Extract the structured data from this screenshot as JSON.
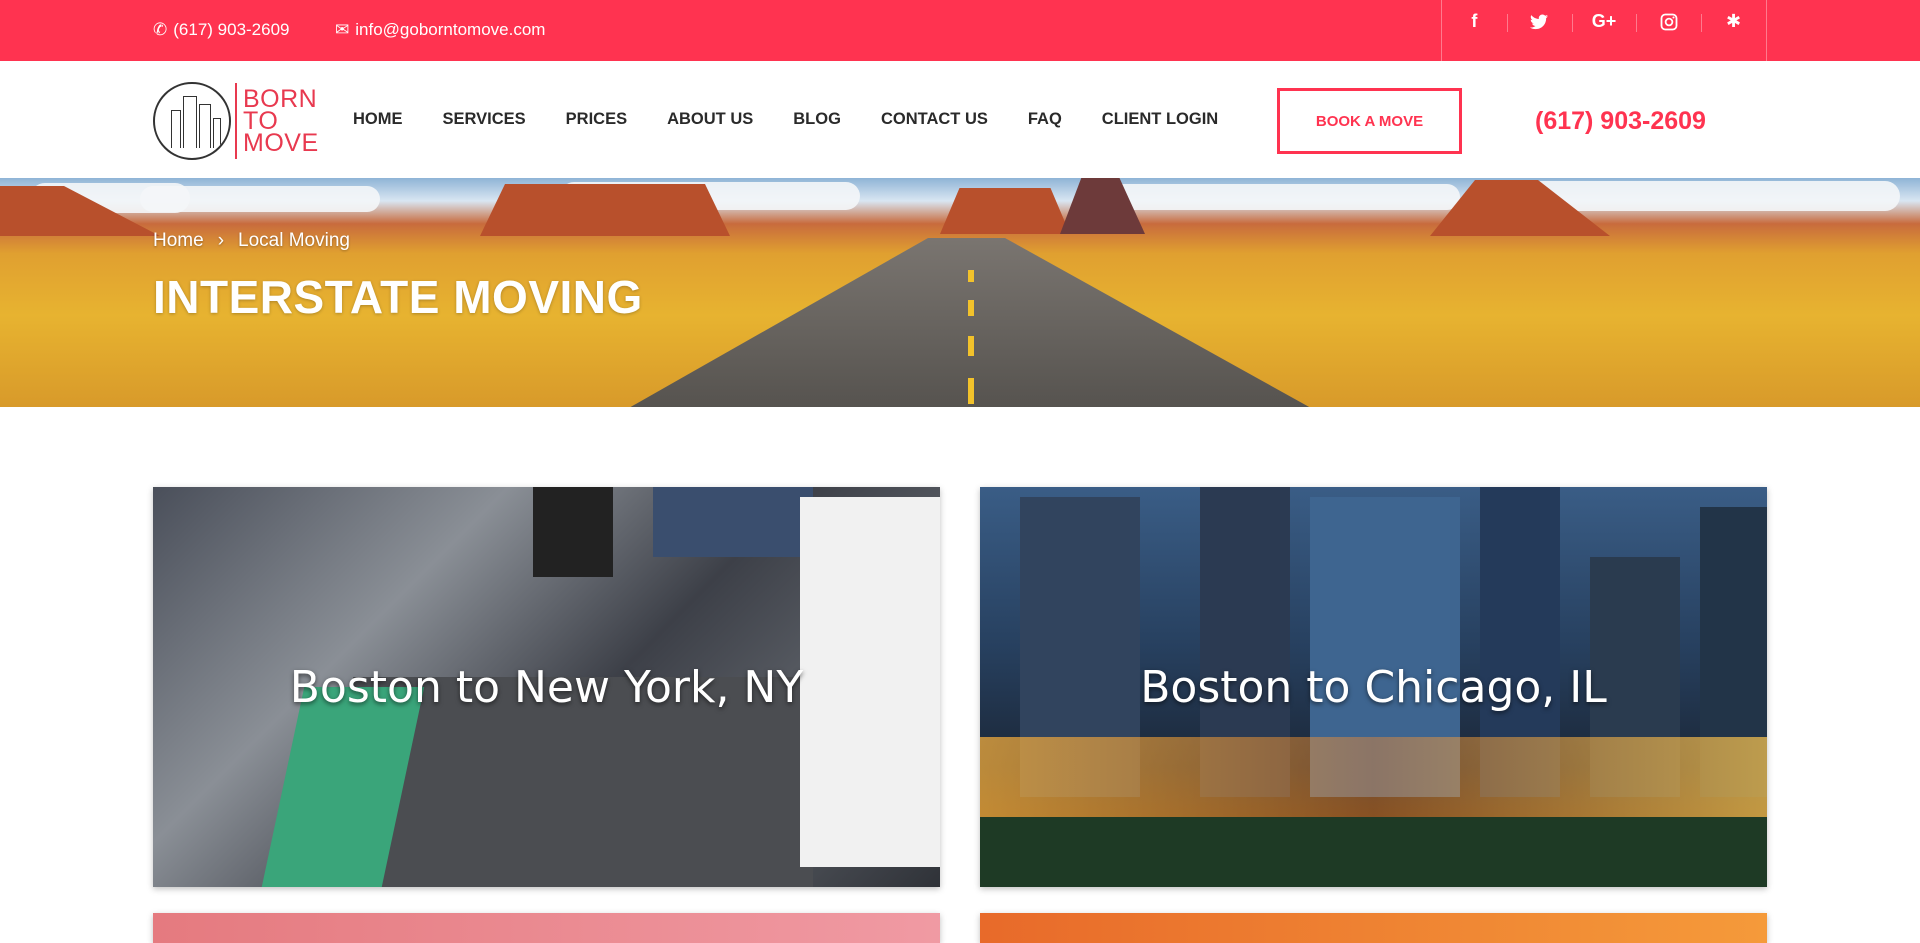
{
  "topbar": {
    "phone": "(617) 903-2609",
    "email": "info@goborntomove.com",
    "social": [
      {
        "icon": "facebook-icon",
        "glyph": "f"
      },
      {
        "icon": "twitter-icon",
        "glyph": "🐦"
      },
      {
        "icon": "google-plus-icon",
        "glyph": "G+"
      },
      {
        "icon": "instagram-icon",
        "glyph": "◎"
      },
      {
        "icon": "yelp-icon",
        "glyph": "✱"
      }
    ]
  },
  "header": {
    "logo": {
      "line1": "BORN",
      "line2": "TO",
      "line3": "MOVE"
    },
    "nav": [
      "HOME",
      "SERVICES",
      "PRICES",
      "ABOUT US",
      "BLOG",
      "CONTACT US",
      "FAQ",
      "CLIENT LOGIN"
    ],
    "book_label": "BOOK A MOVE",
    "phone": "(617) 903-2609"
  },
  "hero": {
    "breadcrumb": [
      "Home",
      "Local Moving"
    ],
    "separator": "›",
    "title": "INTERSTATE MOVING"
  },
  "cards": [
    {
      "label": "Boston to New York, NY"
    },
    {
      "label": "Boston to Chicago, IL"
    }
  ],
  "colors": {
    "brand": "#ff3350",
    "text": "#2a2a2a"
  }
}
